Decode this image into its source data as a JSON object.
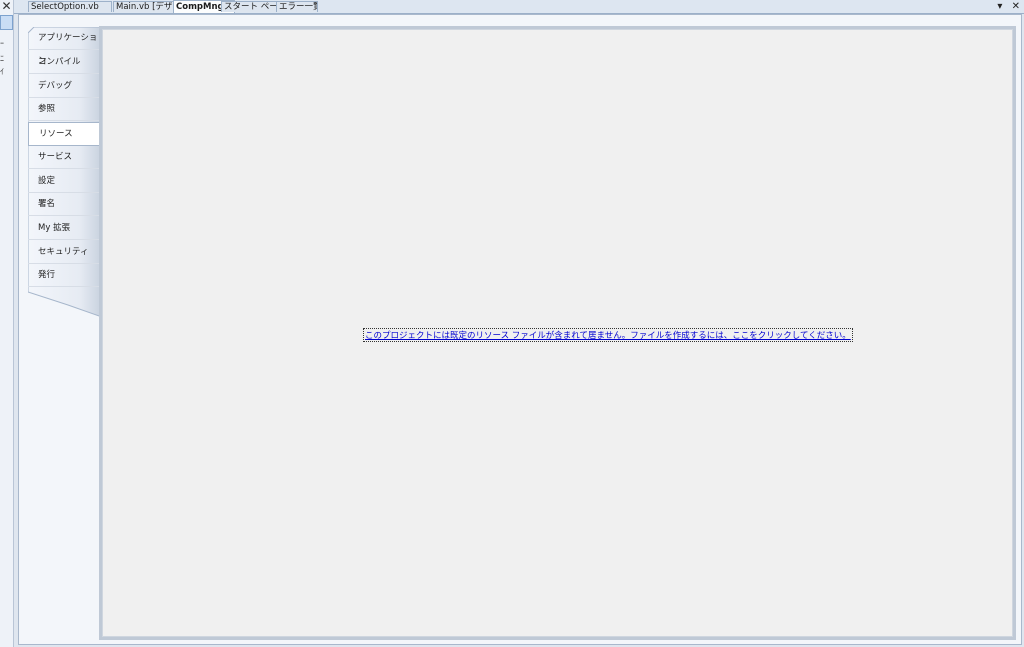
{
  "left_strip": {
    "close_glyph": "✕",
    "ticks": [
      "ｰ",
      "ﾆ",
      "ｲ"
    ]
  },
  "tabs": [
    {
      "label": "SelectOption.vb",
      "active": false
    },
    {
      "label": "Main.vb [デザイン]",
      "active": false
    },
    {
      "label": "CompMng",
      "active": true
    },
    {
      "label": "スタート ページ",
      "active": false
    },
    {
      "label": "エラー一覧",
      "active": false
    }
  ],
  "tab_controls": {
    "dropdown": "▾",
    "close": "✕"
  },
  "sidenav": {
    "items": [
      {
        "label": "アプリケーション",
        "selected": false
      },
      {
        "label": "コンパイル",
        "selected": false
      },
      {
        "label": "デバッグ",
        "selected": false
      },
      {
        "label": "参照",
        "selected": false
      },
      {
        "label": "リソース",
        "selected": true
      },
      {
        "label": "サービス",
        "selected": false
      },
      {
        "label": "設定",
        "selected": false
      },
      {
        "label": "署名",
        "selected": false
      },
      {
        "label": "My 拡張",
        "selected": false
      },
      {
        "label": "セキュリティ",
        "selected": false
      },
      {
        "label": "発行",
        "selected": false
      }
    ]
  },
  "content": {
    "create_resource_link": "このプロジェクトには既定のリソース ファイルが含まれて居ません。ファイルを作成するには、ここをクリックしてください。"
  },
  "colors": {
    "link": "#0000d0",
    "panel_border": "#bfc9d6",
    "panel_bg": "#f0f0f0",
    "tab_bg": "#dde5ef"
  }
}
